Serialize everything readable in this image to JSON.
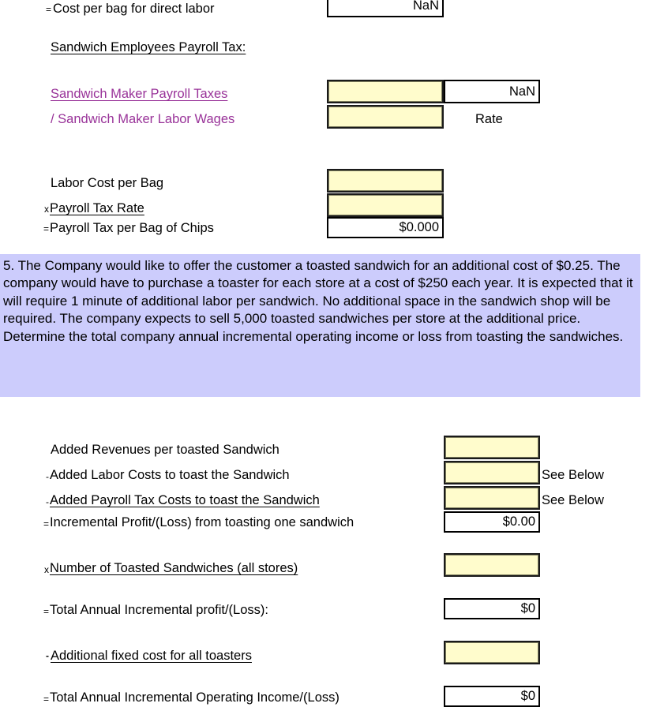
{
  "colors": {
    "input_fill": "#fffccc",
    "callout_bg": "#ccccfc",
    "purple_text": "#993399",
    "border": "#000000"
  },
  "section_top": {
    "cost_per_bag_row": {
      "operator": "=",
      "label": "Cost per bag for direct labor",
      "value": "NaN"
    },
    "heading": "Sandwich Employees Payroll Tax:",
    "payroll_tax_rows": [
      {
        "operator": "",
        "label": "Sandwich Maker Payroll Taxes",
        "input_value": "",
        "result": "NaN"
      },
      {
        "operator": "",
        "label": "/ Sandwich Maker Labor Wages",
        "input_value": "",
        "result": "Rate"
      }
    ]
  },
  "section_labor": {
    "rows": [
      {
        "operator": "",
        "label": "Labor Cost per Bag",
        "value": ""
      },
      {
        "operator": "x",
        "label": "Payroll Tax Rate",
        "value": ""
      },
      {
        "operator": "=",
        "label": "Payroll Tax per Bag of Chips",
        "value": "$0.000"
      }
    ]
  },
  "callout": {
    "number": "5.",
    "text": "5. The Company would like to offer the customer a toasted sandwich for an additional cost of $0.25. The company would have to purchase a toaster for each store at a cost of $250 each year. It is expected that it will require 1 minute of additional labor per sandwich. No additional space in the sandwich shop will be required. The company expects to sell 5,000 toasted sandwiches per store at the additional price. Determine the total company annual incremental operating income or loss from toasting the sandwiches."
  },
  "section_toasting": {
    "rows": [
      {
        "operator": "",
        "label": "Added Revenues per toasted Sandwich",
        "value": "",
        "note": "",
        "type": "input"
      },
      {
        "operator": "-",
        "label": "Added Labor Costs to toast the Sandwich",
        "value": "",
        "note": "See Below",
        "type": "input"
      },
      {
        "operator": "-",
        "label": "Added Payroll Tax Costs to toast the Sandwich",
        "value": "",
        "note": "See Below",
        "type": "input"
      },
      {
        "operator": "=",
        "label": "Incremental Profit/(Loss) from toasting one sandwich",
        "value": "$0.00",
        "note": "",
        "type": "result"
      },
      {
        "operator": "x",
        "label": "Number of Toasted Sandwiches (all stores)",
        "value": "",
        "note": "",
        "type": "input"
      },
      {
        "operator": "=",
        "label": "Total Annual Incremental profit/(Loss):",
        "value": "$0",
        "note": "",
        "type": "result"
      },
      {
        "operator": "-",
        "label": "Additional fixed cost for all toasters",
        "value": "",
        "note": "",
        "type": "input"
      },
      {
        "operator": "=",
        "label": "Total Annual Incremental Operating Income/(Loss)",
        "value": "$0",
        "note": "",
        "type": "result"
      }
    ]
  }
}
